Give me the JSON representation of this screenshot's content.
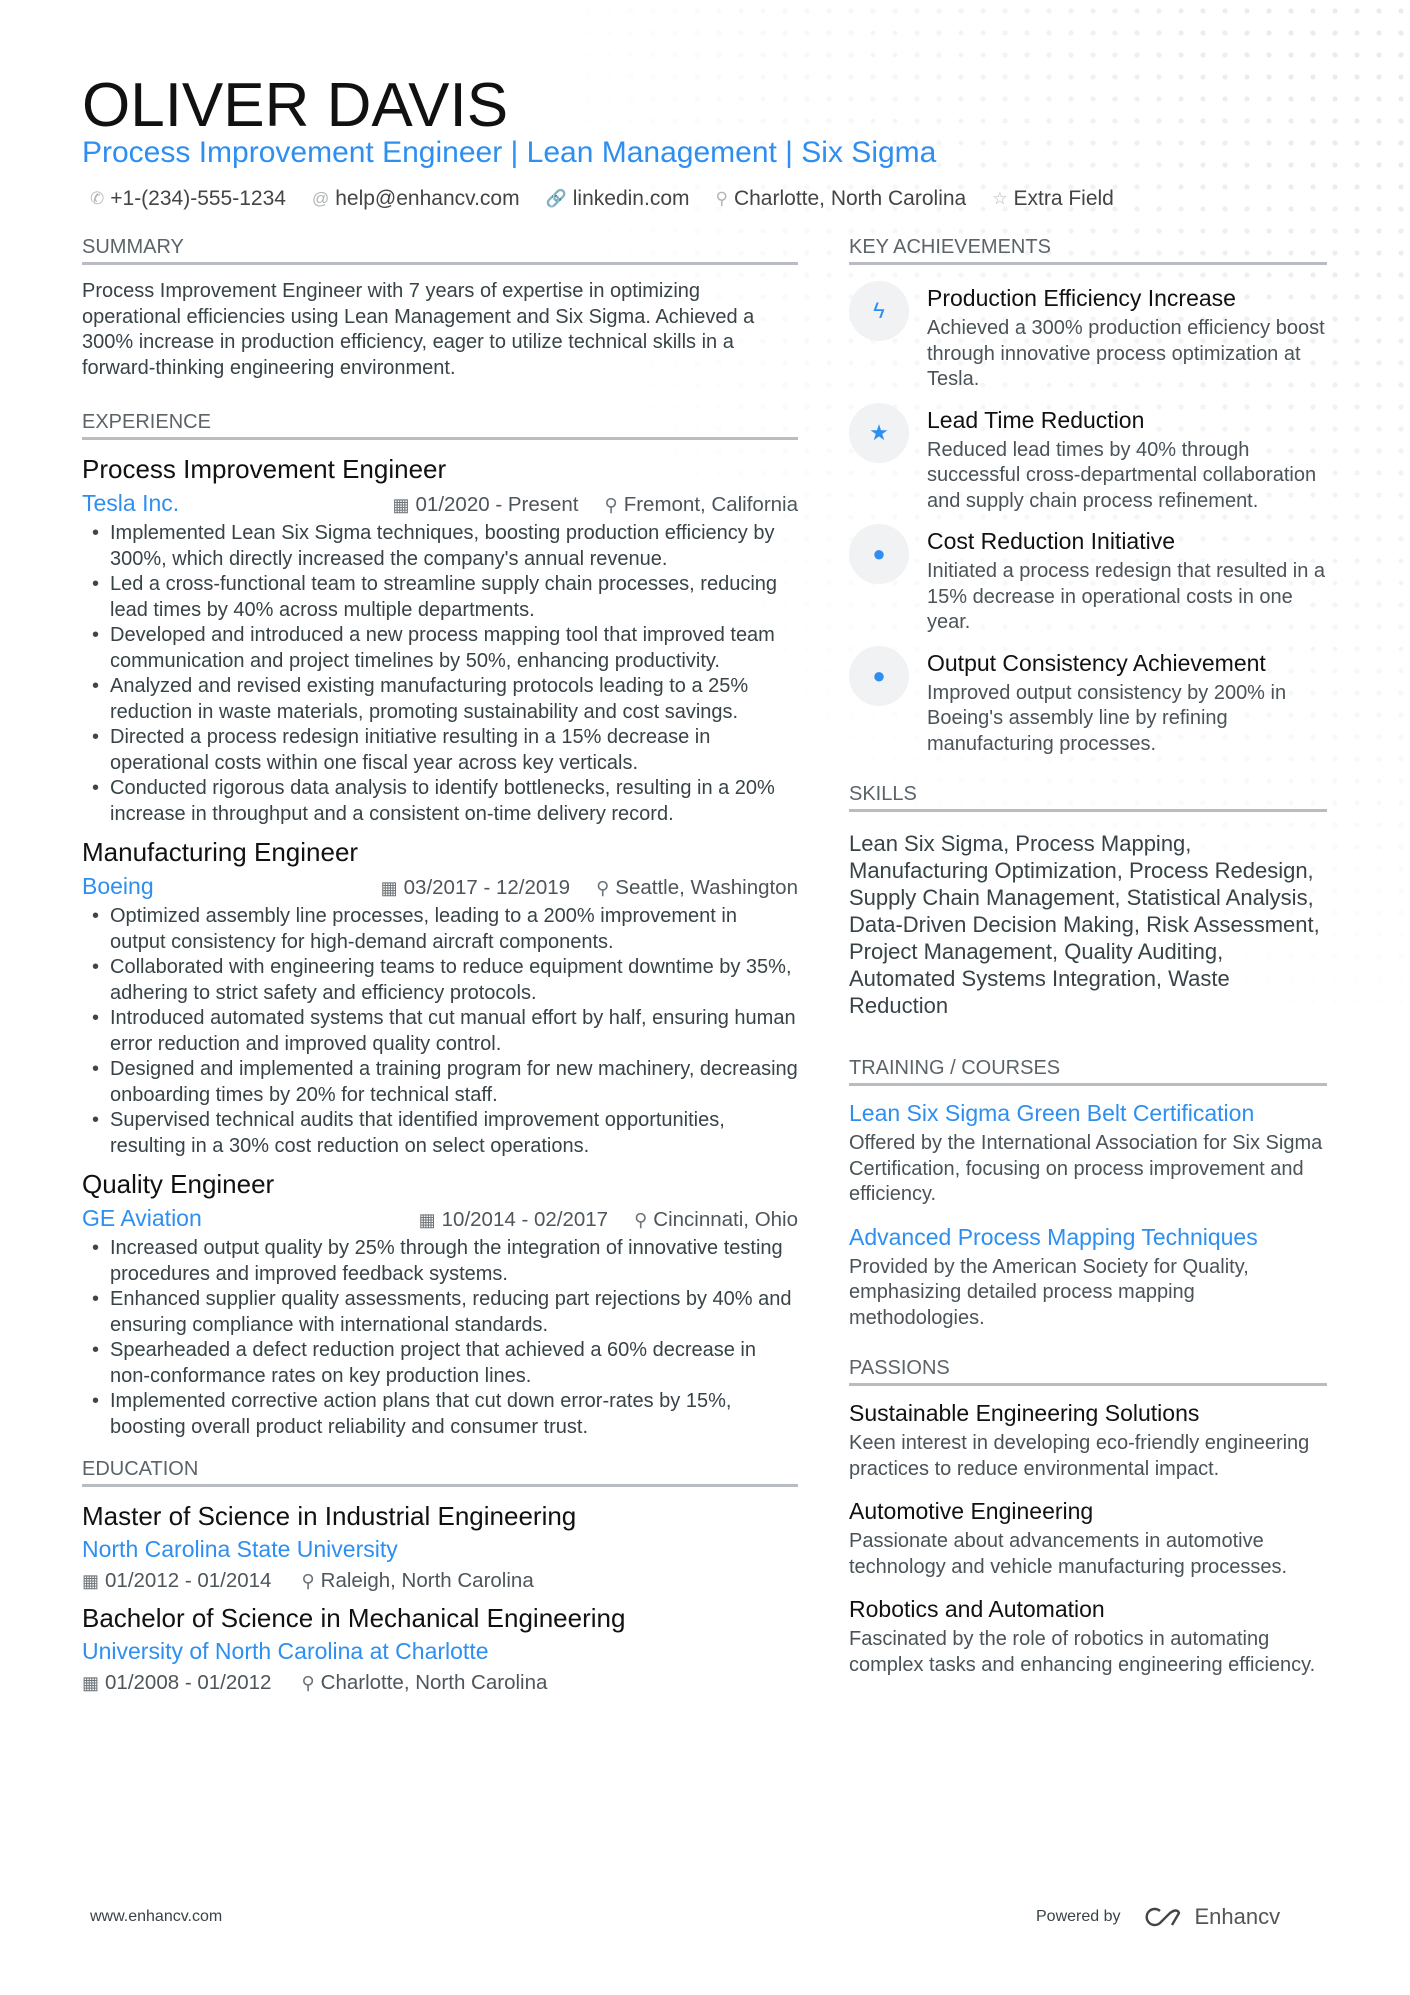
{
  "header": {
    "name": "OLIVER DAVIS",
    "title": "Process Improvement Engineer | Lean Management | Six Sigma",
    "contacts": [
      {
        "icon": "phone-icon",
        "glyph": "✆",
        "text": "+1-(234)-555-1234"
      },
      {
        "icon": "at-icon",
        "glyph": "@",
        "text": "help@enhancv.com"
      },
      {
        "icon": "link-icon",
        "glyph": "🔗",
        "text": "linkedin.com"
      },
      {
        "icon": "location-icon",
        "glyph": "⚲",
        "text": "Charlotte, North Carolina"
      },
      {
        "icon": "star-icon",
        "glyph": "☆",
        "text": "Extra Field"
      }
    ]
  },
  "summary": {
    "heading": "Summary",
    "text": "Process Improvement Engineer with 7 years of expertise in optimizing operational efficiencies using Lean Management and Six Sigma. Achieved a 300% increase in production efficiency, eager to utilize technical skills in a forward-thinking engineering environment."
  },
  "experience": {
    "heading": "Experience",
    "jobs": [
      {
        "title": "Process Improvement Engineer",
        "company": "Tesla Inc.",
        "dates": "01/2020 - Present",
        "location": "Fremont, California",
        "bullets": [
          "Implemented Lean Six Sigma techniques, boosting production efficiency by 300%, which directly increased the company's annual revenue.",
          "Led a cross-functional team to streamline supply chain processes, reducing lead times by 40% across multiple departments.",
          "Developed and introduced a new process mapping tool that improved team communication and project timelines by 50%, enhancing productivity.",
          "Analyzed and revised existing manufacturing protocols leading to a 25% reduction in waste materials, promoting sustainability and cost savings.",
          "Directed a process redesign initiative resulting in a 15% decrease in operational costs within one fiscal year across key verticals.",
          "Conducted rigorous data analysis to identify bottlenecks, resulting in a 20% increase in throughput and a consistent on-time delivery record."
        ]
      },
      {
        "title": "Manufacturing Engineer",
        "company": "Boeing",
        "dates": "03/2017 - 12/2019",
        "location": "Seattle, Washington",
        "bullets": [
          "Optimized assembly line processes, leading to a 200% improvement in output consistency for high-demand aircraft components.",
          "Collaborated with engineering teams to reduce equipment downtime by 35%, adhering to strict safety and efficiency protocols.",
          "Introduced automated systems that cut manual effort by half, ensuring human error reduction and improved quality control.",
          "Designed and implemented a training program for new machinery, decreasing onboarding times by 20% for technical staff.",
          "Supervised technical audits that identified improvement opportunities, resulting in a 30% cost reduction on select operations."
        ]
      },
      {
        "title": "Quality Engineer",
        "company": "GE Aviation",
        "dates": "10/2014 - 02/2017",
        "location": "Cincinnati, Ohio",
        "bullets": [
          "Increased output quality by 25% through the integration of innovative testing procedures and improved feedback systems.",
          "Enhanced supplier quality assessments, reducing part rejections by 40% and ensuring compliance with international standards.",
          "Spearheaded a defect reduction project that achieved a 60% decrease in non-conformance rates on key production lines.",
          "Implemented corrective action plans that cut down error-rates by 15%, boosting overall product reliability and consumer trust."
        ]
      }
    ]
  },
  "education": {
    "heading": "Education",
    "items": [
      {
        "degree": "Master of Science in Industrial Engineering",
        "school": "North Carolina State University",
        "dates": "01/2012 - 01/2014",
        "location": "Raleigh, North Carolina"
      },
      {
        "degree": "Bachelor of Science in Mechanical Engineering",
        "school": "University of North Carolina at Charlotte",
        "dates": "01/2008 - 01/2012",
        "location": "Charlotte, North Carolina"
      }
    ]
  },
  "achievements": {
    "heading": "Key Achievements",
    "items": [
      {
        "icon": "bolt-icon",
        "glyph": "ϟ",
        "title": "Production Efficiency Increase",
        "text": "Achieved a 300% production efficiency boost through innovative process optimization at Tesla."
      },
      {
        "icon": "star-icon",
        "glyph": "★",
        "title": "Lead Time Reduction",
        "text": "Reduced lead times by 40% through successful cross-departmental collaboration and supply chain process refinement."
      },
      {
        "icon": "brain-head-icon",
        "glyph": "●",
        "title": "Cost Reduction Initiative",
        "text": "Initiated a process redesign that resulted in a 15% decrease in operational costs in one year."
      },
      {
        "icon": "brain-head-icon",
        "glyph": "●",
        "title": "Output Consistency Achievement",
        "text": "Improved output consistency by 200% in Boeing's assembly line by refining manufacturing processes."
      }
    ]
  },
  "skills": {
    "heading": "Skills",
    "text": "Lean Six Sigma, Process Mapping, Manufacturing Optimization, Process Redesign, Supply Chain Management, Statistical Analysis, Data-Driven Decision Making, Risk Assessment, Project Management, Quality Auditing, Automated Systems Integration, Waste Reduction"
  },
  "training": {
    "heading": "Training / Courses",
    "items": [
      {
        "title": "Lean Six Sigma Green Belt Certification",
        "text": "Offered by the International Association for Six Sigma Certification, focusing on process improvement and efficiency."
      },
      {
        "title": "Advanced Process Mapping Techniques",
        "text": "Provided by the American Society for Quality, emphasizing detailed process mapping methodologies."
      }
    ]
  },
  "passions": {
    "heading": "Passions",
    "items": [
      {
        "title": "Sustainable Engineering Solutions",
        "text": "Keen interest in developing eco-friendly engineering practices to reduce environmental impact."
      },
      {
        "title": "Automotive Engineering",
        "text": "Passionate about advancements in automotive technology and vehicle manufacturing processes."
      },
      {
        "title": "Robotics and Automation",
        "text": "Fascinated by the role of robotics in automating complex tasks and enhancing engineering efficiency."
      }
    ]
  },
  "footer": {
    "website": "www.enhancv.com",
    "powered_by": "Powered by",
    "brand": "Enhancv"
  },
  "colors": {
    "accent": "#2e8ff0",
    "text": "#384347",
    "heading": "#111111"
  }
}
